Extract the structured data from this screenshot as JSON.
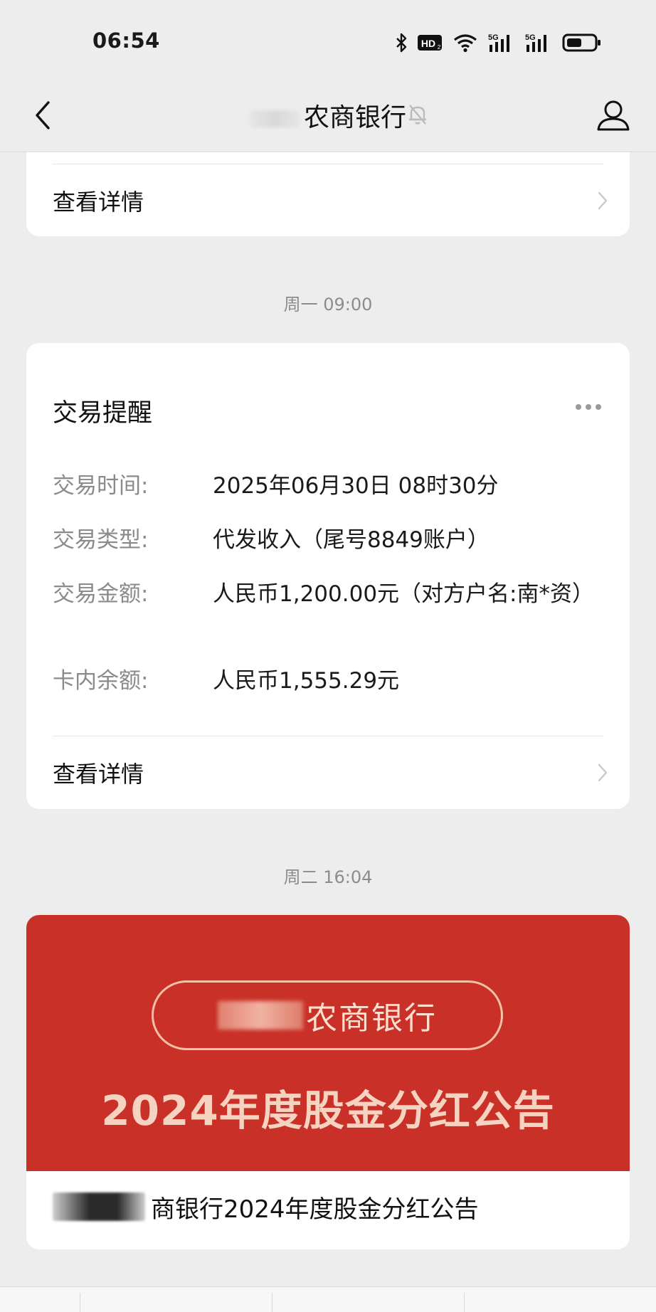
{
  "status_bar": {
    "time": "06:54",
    "icons": [
      "bluetooth-icon",
      "hd-icon",
      "wifi-icon",
      "signal-5g-icon",
      "signal-5g-icon",
      "battery-icon"
    ],
    "hd_label": "HD",
    "net_label_1": "5G",
    "net_label_2": "5G"
  },
  "nav": {
    "title": "农商银行",
    "back_icon": "chevron-left-icon",
    "mute_icon": "bell-muted-icon",
    "profile_icon": "person-icon"
  },
  "top_card": {
    "detail_label": "查看详情"
  },
  "separators": {
    "first": "周一 09:00",
    "second": "周二 16:04"
  },
  "transaction_card": {
    "title": "交易提醒",
    "rows": [
      {
        "key": "交易时间:",
        "value": "2025年06月30日 08时30分"
      },
      {
        "key": "交易类型:",
        "value": "代发收入（尾号8849账户）"
      },
      {
        "key": "交易金额:",
        "value": "人民币1,200.00元（对方户名:南*资）"
      },
      {
        "key": "卡内余额:",
        "value": "人民币1,555.29元"
      }
    ],
    "detail_label": "查看详情"
  },
  "banner_card": {
    "pill_text": "农商银行",
    "heading": "2024年度股金分红公告",
    "caption": "商银行2024年度股金分红公告"
  },
  "colors": {
    "background": "#ededed",
    "card": "#ffffff",
    "banner_red": "#c93027",
    "muted_text": "#8a8a8a"
  }
}
